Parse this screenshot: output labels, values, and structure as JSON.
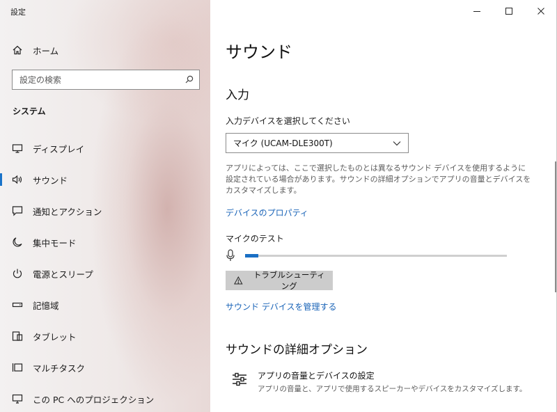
{
  "window": {
    "title": "設定"
  },
  "sidebar": {
    "home_label": "ホーム",
    "search_placeholder": "設定の検索",
    "section_label": "システム",
    "items": [
      {
        "label": "ディスプレイ",
        "icon": "monitor-icon"
      },
      {
        "label": "サウンド",
        "icon": "speaker-icon",
        "selected": true
      },
      {
        "label": "通知とアクション",
        "icon": "notification-icon"
      },
      {
        "label": "集中モード",
        "icon": "moon-icon"
      },
      {
        "label": "電源とスリープ",
        "icon": "power-icon"
      },
      {
        "label": "記憶域",
        "icon": "storage-icon"
      },
      {
        "label": "タブレット",
        "icon": "tablet-icon"
      },
      {
        "label": "マルチタスク",
        "icon": "multitask-icon"
      },
      {
        "label": "この PC へのプロジェクション",
        "icon": "projection-icon"
      }
    ]
  },
  "main": {
    "title": "サウンド",
    "input_heading": "入力",
    "device_select_label": "入力デバイスを選択してください",
    "device_selected": "マイク (UCAM-DLE300T)",
    "description": "アプリによっては、ここで選択したものとは異なるサウンド デバイスを使用するように設定されている場合があります。サウンドの詳細オプションでアプリの音量とデバイスをカスタマイズします。",
    "device_properties_link": "デバイスのプロパティ",
    "mic_test_label": "マイクのテスト",
    "mic_level_fraction": 0.05,
    "troubleshoot_label": "トラブルシューティング",
    "manage_devices_link": "サウンド デバイスを管理する",
    "advanced_heading": "サウンドの詳細オプション",
    "app_volume_title": "アプリの音量とデバイスの設定",
    "app_volume_desc": "アプリの音量と、アプリで使用するスピーカーやデバイスをカスタマイズします。"
  },
  "colors": {
    "accent": "#1a73c9",
    "link": "#1a64b8",
    "button_bg": "#cccccc"
  }
}
